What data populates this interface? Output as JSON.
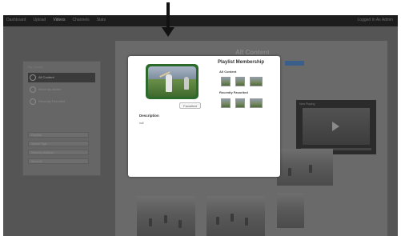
{
  "app": {
    "nav": [
      "Dashboard",
      "Upload",
      "Videos",
      "Channels",
      "Stats"
    ],
    "active_nav": "Videos",
    "util_links": "Logged In As Admin"
  },
  "sidebar": {
    "header": "My Library",
    "items": [
      {
        "label": "All Content",
        "selected": true
      },
      {
        "label": "Recently Added",
        "selected": false
      },
      {
        "label": "Recently Favorited",
        "selected": false
      }
    ],
    "fields": [
      "Playlists",
      "Search Tags",
      "Recently Watched",
      "Show All"
    ]
  },
  "main": {
    "title": "All Content"
  },
  "video_player": {
    "title": "Now Playing"
  },
  "modal": {
    "favorited_label": "Favorited",
    "description_title": "Description",
    "description_text": "null",
    "playlist_title": "Playlist Membership",
    "sections": [
      {
        "title": "All Content"
      },
      {
        "title": "Recently Favorited"
      }
    ]
  }
}
